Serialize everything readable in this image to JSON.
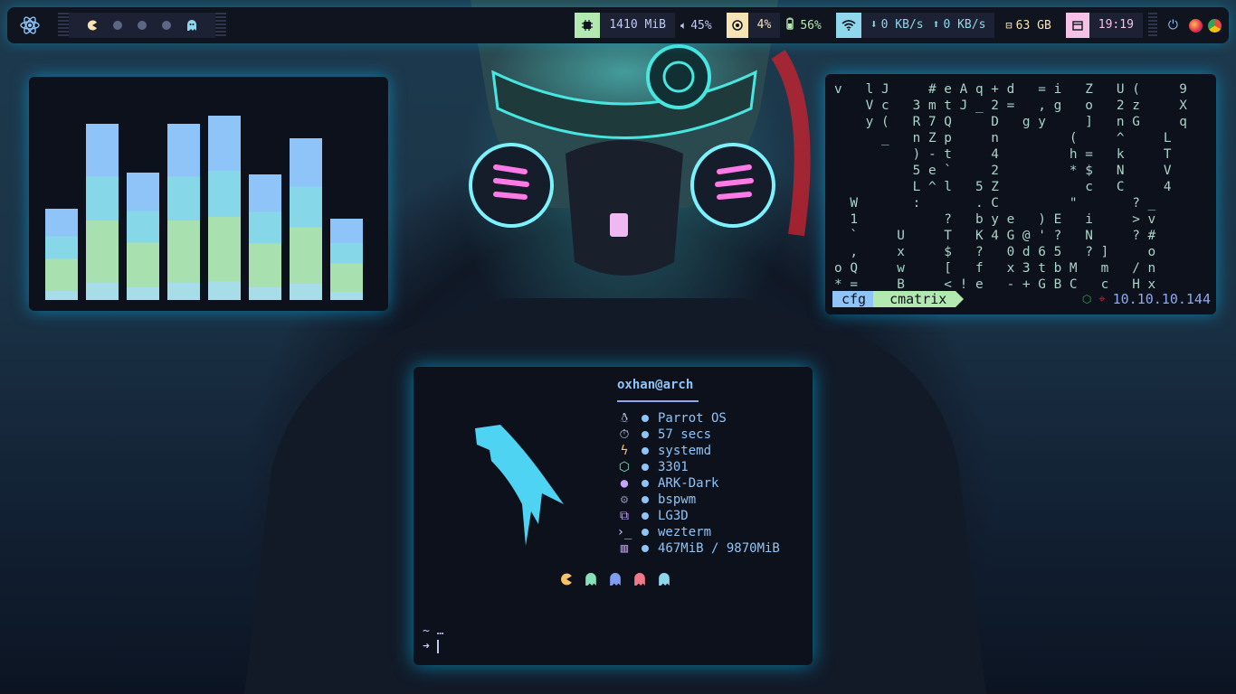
{
  "bar": {
    "workspaces": [
      "active",
      "empty",
      "empty",
      "empty",
      "ghost"
    ],
    "memory": "1410 MiB",
    "volume": "45%",
    "cpu": "4%",
    "battery": "56%",
    "net_down": "0 KB/s",
    "net_up": "0 KB/s",
    "disk": "63 GB",
    "time": "19:19",
    "colors": {
      "memory": "#b3e8b0",
      "cpu": "#f7e3b4",
      "clock": "#f5c1e4",
      "wifi": "#8fd7ec"
    }
  },
  "visualizer": {
    "levels": [
      0.48,
      0.93,
      0.67,
      0.93,
      0.97,
      0.66,
      0.85,
      0.43
    ]
  },
  "matrix": {
    "lines": [
      "v   l J     # e A q + d   = i   Z   U (     9",
      "    V c   3 m t J _ 2 =   , g   o   2 z     X",
      "    y (   R 7 Q     D   g y     ]   n G     q",
      "      _   n Z p     n         (     ^     L",
      "          ) - t     4         h =   k     T",
      "          5 e `     2         * $   N     V",
      "          L ^ l   5 Z           c   C     4",
      "  W       :       . C         \"       ? _",
      "  1           ?   b y e   ) E   i     > v",
      "  `     U     T   K 4 G @ ' ?   N     ? #",
      "  ,     x     $   ?   0 d 6 5   ? ]     o",
      "o Q     w     [   f   x 3 t b M   m   / n",
      "* =     B     < ! e   - + G B C   c   H x"
    ],
    "prompt_dir": "cfg",
    "prompt_cmd": "cmatrix",
    "ip": "10.10.10.144"
  },
  "fetch": {
    "user": "oxhan@arch",
    "rows": [
      {
        "icon": "linux-icon",
        "value": "Parrot OS"
      },
      {
        "icon": "timer-icon",
        "value": "57 secs"
      },
      {
        "icon": "init-icon",
        "value": "systemd"
      },
      {
        "icon": "package-icon",
        "value": "3301"
      },
      {
        "icon": "palette-icon",
        "value": "ARK-Dark"
      },
      {
        "icon": "wm-icon",
        "value": "bspwm"
      },
      {
        "icon": "windows-icon",
        "value": "LG3D"
      },
      {
        "icon": "terminal-icon",
        "value": "wezterm"
      },
      {
        "icon": "memory-icon",
        "value": "467MiB / 9870MiB"
      }
    ],
    "prompt_line1": "~ …",
    "prompt_line2": "➜"
  }
}
